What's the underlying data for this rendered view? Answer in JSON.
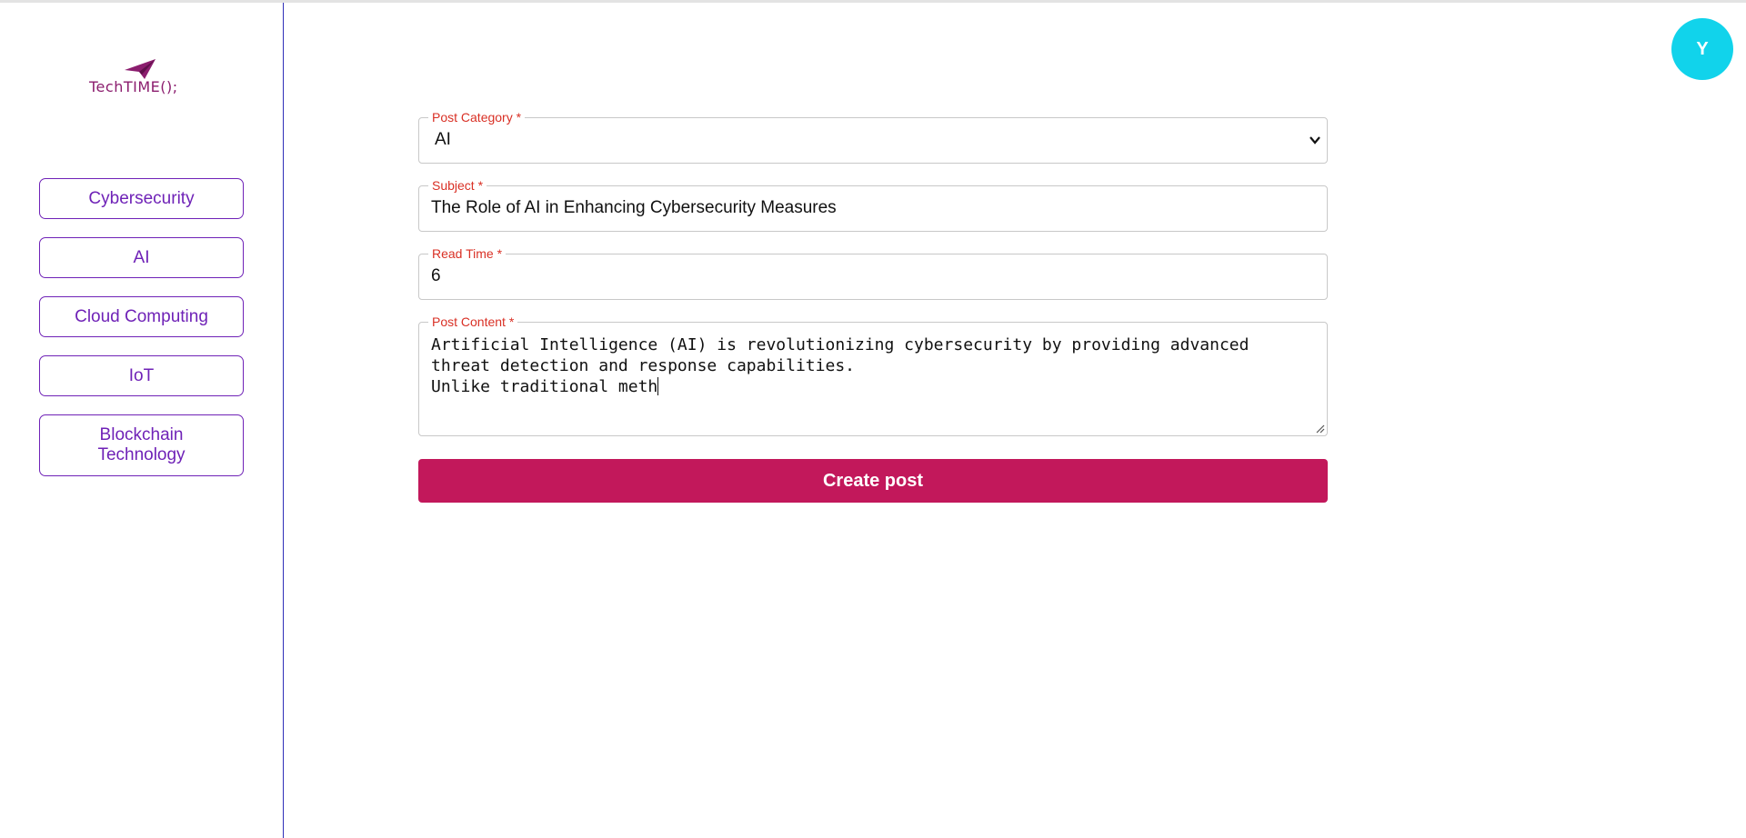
{
  "brand": {
    "logo_text": "TechTIME();",
    "logo_icon": "paper-plane-icon",
    "logo_color": "#8b1d6e"
  },
  "sidebar": {
    "items": [
      {
        "label": "Cybersecurity"
      },
      {
        "label": "AI"
      },
      {
        "label": "Cloud Computing"
      },
      {
        "label": "IoT"
      },
      {
        "label": "Blockchain Technology"
      }
    ],
    "accent_color": "#6f22b7"
  },
  "user": {
    "avatar_initial": "Y",
    "avatar_color": "#11d3eb"
  },
  "form": {
    "category": {
      "label": "Post Category *",
      "value": "AI"
    },
    "subject": {
      "label": "Subject *",
      "value": "The Role of AI in Enhancing Cybersecurity Measures"
    },
    "read_time": {
      "label": "Read Time *",
      "value": "6"
    },
    "content": {
      "label": "Post Content *",
      "value": "Artificial Intelligence (AI) is revolutionizing cybersecurity by providing advanced\nthreat detection and response capabilities.\nUnlike traditional meth"
    },
    "submit_label": "Create post",
    "submit_color": "#c2185b",
    "label_color": "#d93025"
  }
}
